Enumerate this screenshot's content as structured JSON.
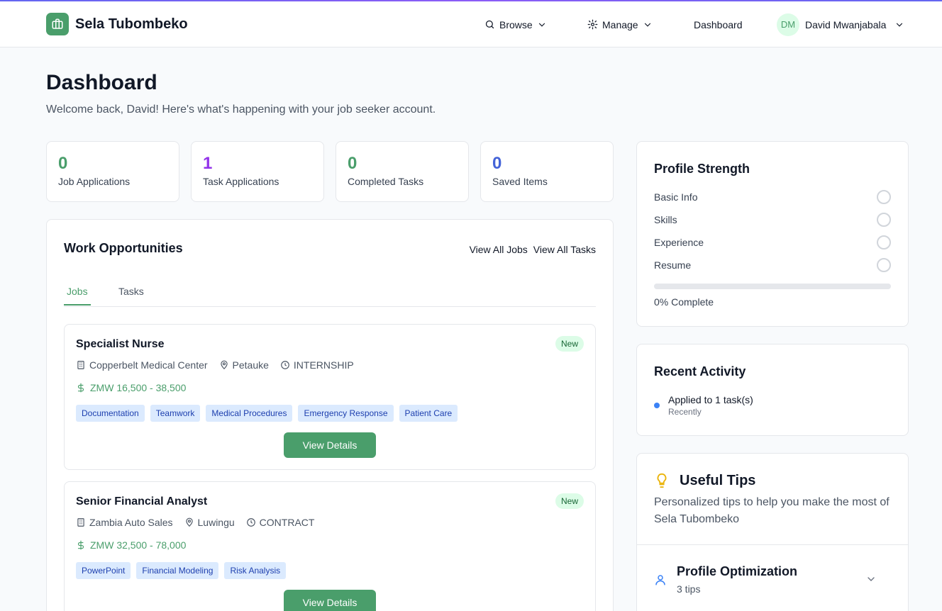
{
  "brand": {
    "name": "Sela Tubombeko",
    "color": "#4a9e6b"
  },
  "nav": {
    "browse": "Browse",
    "manage": "Manage",
    "dashboard": "Dashboard",
    "user_initials": "DM",
    "user_name": "David Mwanjabala"
  },
  "page": {
    "title": "Dashboard",
    "subtitle": "Welcome back, David! Here's what's happening with your job seeker account."
  },
  "stats": [
    {
      "value": "0",
      "label": "Job Applications",
      "color": "#4a9e6b"
    },
    {
      "value": "1",
      "label": "Task Applications",
      "color": "#9333ea"
    },
    {
      "value": "0",
      "label": "Completed Tasks",
      "color": "#4a9e6b"
    },
    {
      "value": "0",
      "label": "Saved Items",
      "color": "#4463d8"
    }
  ],
  "work": {
    "title": "Work Opportunities",
    "view_all_jobs": "View All Jobs",
    "view_all_tasks": "View All Tasks",
    "tabs": [
      "Jobs",
      "Tasks"
    ],
    "jobs": [
      {
        "title": "Specialist Nurse",
        "badge": "New",
        "company": "Copperbelt Medical Center",
        "location": "Petauke",
        "type": "INTERNSHIP",
        "salary": "ZMW 16,500 - 38,500",
        "tags": [
          "Documentation",
          "Teamwork",
          "Medical Procedures",
          "Emergency Response",
          "Patient Care"
        ],
        "button": "View Details"
      },
      {
        "title": "Senior Financial Analyst",
        "badge": "New",
        "company": "Zambia Auto Sales",
        "location": "Luwingu",
        "type": "CONTRACT",
        "salary": "ZMW 32,500 - 78,000",
        "tags": [
          "PowerPoint",
          "Financial Modeling",
          "Risk Analysis"
        ],
        "button": "View Details"
      }
    ]
  },
  "profile_strength": {
    "title": "Profile Strength",
    "items": [
      "Basic Info",
      "Skills",
      "Experience",
      "Resume"
    ],
    "progress": 0,
    "complete_text": "0% Complete"
  },
  "recent_activity": {
    "title": "Recent Activity",
    "items": [
      {
        "text": "Applied to 1 task(s)",
        "time": "Recently"
      }
    ]
  },
  "tips": {
    "title": "Useful Tips",
    "subtitle": "Personalized tips to help you make the most of Sela Tubombeko",
    "sections": [
      {
        "title": "Profile Optimization",
        "count": "3 tips"
      }
    ]
  }
}
